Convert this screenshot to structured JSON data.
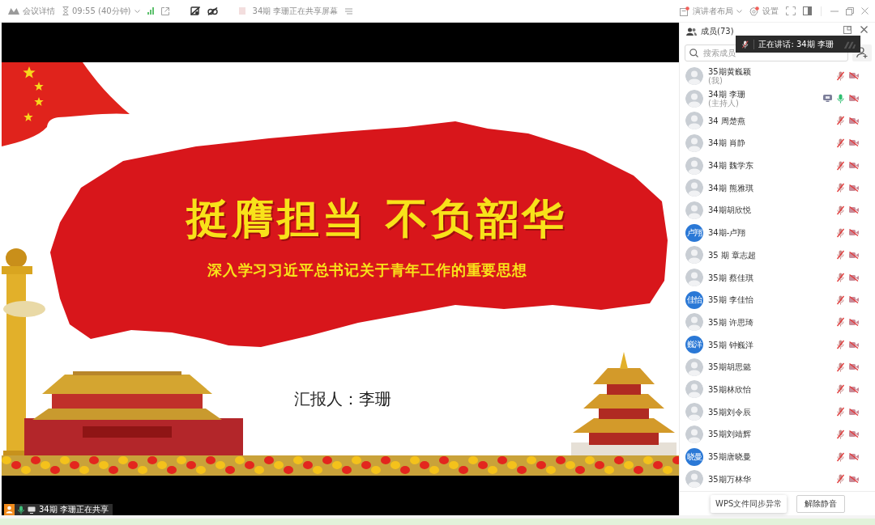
{
  "topbar": {
    "meeting_info": "会议详情",
    "time": "09:55 (40分钟)",
    "sharing_notice": "34期 李珊正在共享屏幕",
    "layout_button": "演讲者布局",
    "settings_button": "设置"
  },
  "shared_screen": {
    "slide": {
      "title": "挺膺担当 不负韶华",
      "subtitle": "深入学习习近平总书记关于青年工作的重要思想",
      "presenter": "汇报人：李珊"
    },
    "share_badge": "34期 李珊正在共享"
  },
  "members_panel": {
    "title": "成员(73)",
    "speaking_toast": "正在讲话: 34期 李珊",
    "search": {
      "placeholder": "搜索成员"
    },
    "members": [
      {
        "name": "35期黄巍颖",
        "role": "(我)",
        "avatar": {
          "kind": "photo"
        },
        "sharing": false,
        "muted": true,
        "video_on": false
      },
      {
        "name": "34期 李珊",
        "role": "(主持人)",
        "avatar": {
          "kind": "photo"
        },
        "sharing": true,
        "muted": false,
        "video_on": false
      },
      {
        "name": "34 周楚燕",
        "avatar": {
          "kind": "photo"
        },
        "sharing": false,
        "muted": true,
        "video_on": false
      },
      {
        "name": "34期 肖静",
        "avatar": {
          "kind": "photo"
        },
        "sharing": false,
        "muted": true,
        "video_on": false
      },
      {
        "name": "34期 魏学东",
        "avatar": {
          "kind": "photo"
        },
        "sharing": false,
        "muted": true,
        "video_on": false
      },
      {
        "name": "34期 熊雅琪",
        "avatar": {
          "kind": "photo"
        },
        "sharing": false,
        "muted": true,
        "video_on": false
      },
      {
        "name": "34期胡欣悦",
        "avatar": {
          "kind": "photo"
        },
        "sharing": false,
        "muted": true,
        "video_on": false
      },
      {
        "name": "34期-卢翔",
        "avatar": {
          "kind": "initials",
          "text": "卢翔"
        },
        "sharing": false,
        "muted": true,
        "video_on": false
      },
      {
        "name": "35 期 章志超",
        "avatar": {
          "kind": "photo"
        },
        "sharing": false,
        "muted": true,
        "video_on": false
      },
      {
        "name": "35期 蔡佳琪",
        "avatar": {
          "kind": "photo"
        },
        "sharing": false,
        "muted": true,
        "video_on": false
      },
      {
        "name": "35期 李佳怡",
        "avatar": {
          "kind": "initials",
          "text": "佳怡"
        },
        "sharing": false,
        "muted": true,
        "video_on": false
      },
      {
        "name": "35期 许思琦",
        "avatar": {
          "kind": "photo"
        },
        "sharing": false,
        "muted": true,
        "video_on": false
      },
      {
        "name": "35期 钟巍洋",
        "avatar": {
          "kind": "initials",
          "text": "巍洋"
        },
        "sharing": false,
        "muted": true,
        "video_on": false
      },
      {
        "name": "35期胡思懿",
        "avatar": {
          "kind": "photo"
        },
        "sharing": false,
        "muted": true,
        "video_on": false
      },
      {
        "name": "35期林欣怡",
        "avatar": {
          "kind": "photo"
        },
        "sharing": false,
        "muted": true,
        "video_on": false
      },
      {
        "name": "35期刘令辰",
        "avatar": {
          "kind": "photo"
        },
        "sharing": false,
        "muted": true,
        "video_on": false
      },
      {
        "name": "35期刘靖辉",
        "avatar": {
          "kind": "photo"
        },
        "sharing": false,
        "muted": true,
        "video_on": false
      },
      {
        "name": "35期唐晓曼",
        "avatar": {
          "kind": "initials",
          "text": "晓曼"
        },
        "sharing": false,
        "muted": true,
        "video_on": false
      },
      {
        "name": "35期万林华",
        "avatar": {
          "kind": "photo"
        },
        "sharing": false,
        "muted": true,
        "video_on": false
      }
    ],
    "toast": "WPS文件同步异常",
    "unmute_button": "解除静音"
  }
}
